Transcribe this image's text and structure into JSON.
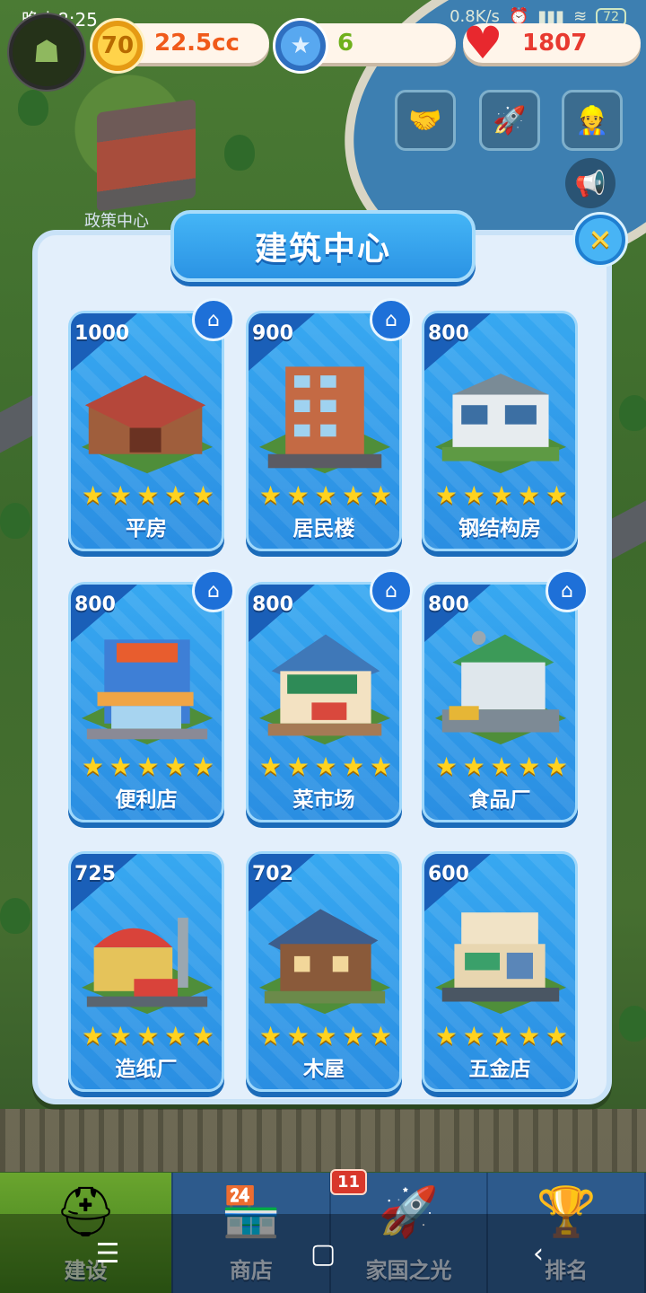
{
  "status_bar": {
    "time": "晚上8:25",
    "net_speed": "0.8K/s",
    "battery": "72"
  },
  "hud": {
    "avatar_icon": "player-avatar",
    "coins": "22.5cc",
    "coin_icon_text": "70",
    "stars": "6",
    "hearts": "1807",
    "policy_center_label": "政策中心",
    "buttons": [
      "handshake-icon",
      "rocket-icon",
      "worker-icon"
    ],
    "speaker_icon": "megaphone-icon"
  },
  "panel": {
    "title": "建筑中心",
    "close_label": "✕",
    "buildings": [
      {
        "name": "平房",
        "price": "1000",
        "stars": 5,
        "home_badge": true,
        "art": "courtyard-house"
      },
      {
        "name": "居民楼",
        "price": "900",
        "stars": 5,
        "home_badge": true,
        "art": "apartment"
      },
      {
        "name": "钢结构房",
        "price": "800",
        "stars": 5,
        "home_badge": false,
        "art": "steel-house"
      },
      {
        "name": "便利店",
        "price": "800",
        "stars": 5,
        "home_badge": true,
        "art": "convenience-store"
      },
      {
        "name": "菜市场",
        "price": "800",
        "stars": 5,
        "home_badge": true,
        "art": "vegetable-market"
      },
      {
        "name": "食品厂",
        "price": "800",
        "stars": 5,
        "home_badge": true,
        "art": "food-factory"
      },
      {
        "name": "造纸厂",
        "price": "725",
        "stars": 5,
        "home_badge": false,
        "art": "paper-mill"
      },
      {
        "name": "木屋",
        "price": "702",
        "stars": 5,
        "home_badge": false,
        "art": "wooden-house"
      },
      {
        "name": "五金店",
        "price": "600",
        "stars": 5,
        "home_badge": false,
        "art": "hardware-store"
      }
    ],
    "star_glyph": "★",
    "home_glyph": "⌂"
  },
  "tabbar": {
    "tabs": [
      {
        "label": "建设",
        "icon": "hardhat-icon",
        "active": true
      },
      {
        "label": "商店",
        "icon": "shop-icon",
        "active": false
      },
      {
        "label": "家国之光",
        "icon": "rocket-icon",
        "active": false
      },
      {
        "label": "排名",
        "icon": "ranking-icon",
        "active": false
      }
    ],
    "shop_badge": "11"
  },
  "system_nav": {
    "menu": "☰",
    "home": "▢",
    "back": "‹"
  },
  "colors": {
    "card_blue": "#2a8ee2",
    "star_gold": "#ffd21f",
    "title_blue": "#2b93e4",
    "close_yellow": "#ffd84a"
  }
}
